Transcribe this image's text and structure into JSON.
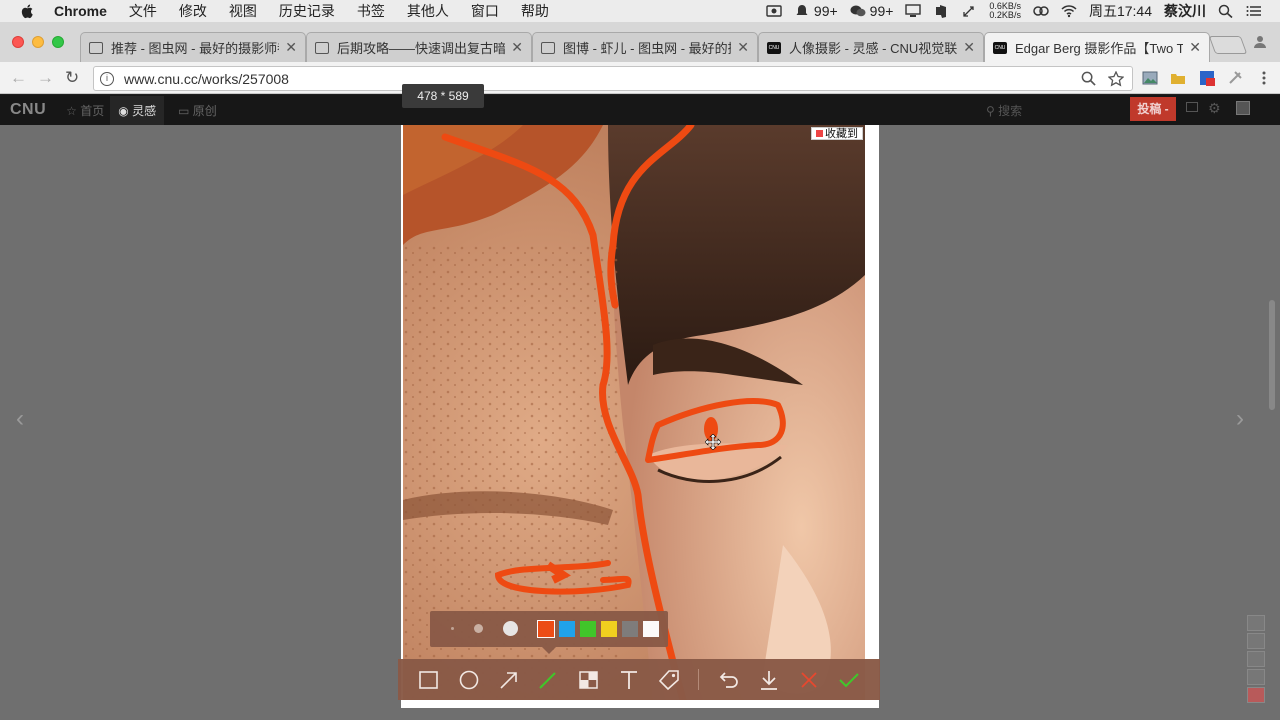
{
  "menubar": {
    "app_name": "Chrome",
    "menus": [
      "文件",
      "修改",
      "视图",
      "历史记录",
      "书签",
      "其他人",
      "窗口",
      "帮助"
    ],
    "notifications_count_1": "99+",
    "notifications_count_2": "99+",
    "net_up": "0.6KB/s",
    "net_down": "0.2KB/s",
    "clock": "周五17:44",
    "user": "蔡汶川"
  },
  "tabs": [
    {
      "title": "推荐 - 图虫网 - 最好的摄影师都"
    },
    {
      "title": "后期攻略——快速调出复古暗色"
    },
    {
      "title": "图博 - 虾儿 - 图虫网 - 最好的摄"
    },
    {
      "title": "人像摄影 - 灵感 - CNU视觉联盟"
    },
    {
      "title": "Edgar Berg 摄影作品【Two Th"
    }
  ],
  "address_bar": {
    "url": "www.cnu.cc/works/257008"
  },
  "site": {
    "logo": "CNU",
    "nav": [
      "首页",
      "灵感",
      "原创"
    ],
    "search_placeholder": "搜索",
    "post_button": "投稿 -"
  },
  "capture": {
    "dimension_label": "478 * 589",
    "favorite_badge": "收藏到"
  },
  "annotation": {
    "colors": [
      "#ee4a12",
      "#1aa3f0",
      "#3cc828",
      "#f2d21c",
      "#7c7c7c",
      "#ffffff"
    ],
    "selected_color": "#ee4a12",
    "tools": [
      "rectangle-tool",
      "ellipse-tool",
      "arrow-tool",
      "pen-tool",
      "mosaic-tool",
      "text-tool",
      "tag-tool",
      "undo",
      "download",
      "cancel",
      "confirm"
    ]
  }
}
